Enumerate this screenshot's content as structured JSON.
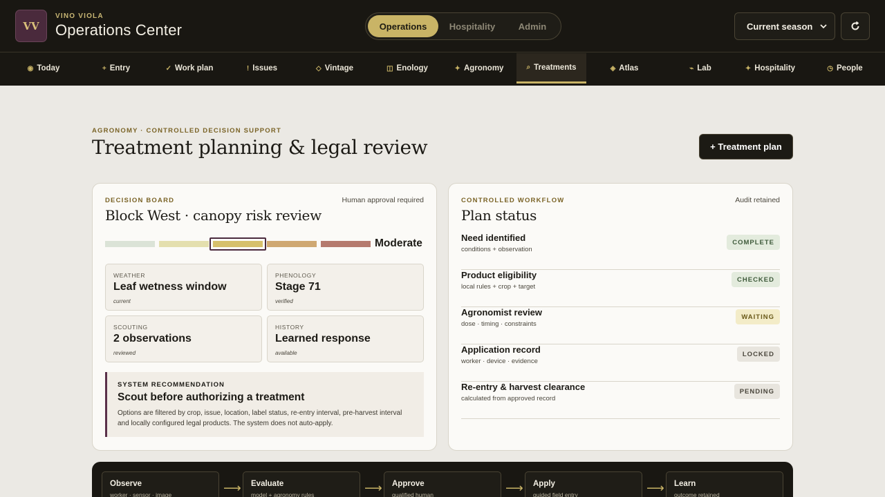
{
  "brand": {
    "logo": "VV",
    "subtitle": "VINO VIOLA",
    "title": "Operations Center"
  },
  "segments": [
    {
      "label": "Operations",
      "active": true
    },
    {
      "label": "Hospitality",
      "active": false
    },
    {
      "label": "Admin",
      "active": false
    }
  ],
  "season_select": {
    "value": "Current season"
  },
  "nav": [
    {
      "label": "Today",
      "icon": "◉"
    },
    {
      "label": "Entry",
      "icon": "+"
    },
    {
      "label": "Work plan",
      "icon": "✓"
    },
    {
      "label": "Issues",
      "icon": "!"
    },
    {
      "label": "Vintage",
      "icon": "◇"
    },
    {
      "label": "Enology",
      "icon": "◫"
    },
    {
      "label": "Agronomy",
      "icon": "✦"
    },
    {
      "label": "Treatments",
      "icon": "⌕",
      "active": true
    },
    {
      "label": "Atlas",
      "icon": "◈"
    },
    {
      "label": "Lab",
      "icon": "⌁"
    },
    {
      "label": "Hospitality",
      "icon": "✦"
    },
    {
      "label": "People",
      "icon": "◷"
    }
  ],
  "page": {
    "eyebrow": "AGRONOMY · CONTROLLED DECISION SUPPORT",
    "title": "Treatment planning & legal review",
    "action": "+ Treatment plan"
  },
  "decision": {
    "eyebrow": "DECISION BOARD",
    "note": "Human approval required",
    "title": "Block West · canopy risk review",
    "risk": {
      "level": "Moderate",
      "selected_index": 2,
      "scale_colors": [
        "#dbe3d7",
        "#e4dfae",
        "#d6c06b",
        "#cfa872",
        "#b57a6e"
      ]
    },
    "metrics": [
      {
        "label": "WEATHER",
        "value": "Leaf wetness window",
        "sub": "current"
      },
      {
        "label": "PHENOLOGY",
        "value": "Stage 71",
        "sub": "verified"
      },
      {
        "label": "SCOUTING",
        "value": "2 observations",
        "sub": "reviewed"
      },
      {
        "label": "HISTORY",
        "value": "Learned response",
        "sub": "available"
      }
    ],
    "recommendation": {
      "label": "SYSTEM RECOMMENDATION",
      "title": "Scout before authorizing a treatment",
      "text": "Options are filtered by crop, issue, location, label status, re-entry interval, pre-harvest interval and locally configured legal products. The system does not auto-apply."
    }
  },
  "workflow": {
    "eyebrow": "CONTROLLED WORKFLOW",
    "note": "Audit retained",
    "title": "Plan status",
    "rows": [
      {
        "title": "Need identified",
        "sub": "conditions + observation",
        "status": "COMPLETE",
        "bg": "#e3ebdd",
        "fg": "#3e5a3a"
      },
      {
        "title": "Product eligibility",
        "sub": "local rules + crop + target",
        "status": "CHECKED",
        "bg": "#e3ebdd",
        "fg": "#3e5a3a"
      },
      {
        "title": "Agronomist review",
        "sub": "dose · timing · constraints",
        "status": "WAITING",
        "bg": "#f3ecc8",
        "fg": "#6a5a1a"
      },
      {
        "title": "Application record",
        "sub": "worker · device · evidence",
        "status": "LOCKED",
        "bg": "#e8e5de",
        "fg": "#4a463c"
      },
      {
        "title": "Re-entry & harvest clearance",
        "sub": "calculated from approved record",
        "status": "PENDING",
        "bg": "#e8e5de",
        "fg": "#4a463c"
      }
    ]
  },
  "pipeline": [
    {
      "title": "Observe",
      "sub": "worker · sensor · image"
    },
    {
      "title": "Evaluate",
      "sub": "model + agronomy rules"
    },
    {
      "title": "Approve",
      "sub": "qualified human"
    },
    {
      "title": "Apply",
      "sub": "guided field entry"
    },
    {
      "title": "Learn",
      "sub": "outcome retained"
    }
  ],
  "arrow_glyph": "⟶"
}
